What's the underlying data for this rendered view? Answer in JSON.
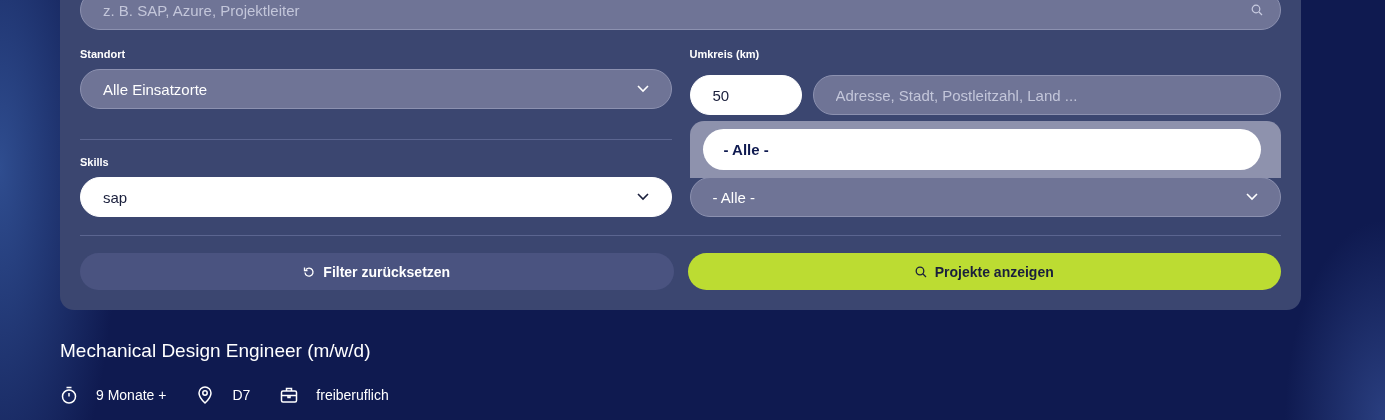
{
  "search": {
    "placeholder": "z. B. SAP, Azure, Projektleiter"
  },
  "location": {
    "label": "Standort",
    "value": "Alle Einsatzorte"
  },
  "radius": {
    "label": "Umkreis (km)",
    "value": "50",
    "address_placeholder": "Adresse, Stadt, Postleitzahl, Land ..."
  },
  "skills": {
    "label": "Skills",
    "value": "sap"
  },
  "open_dropdown": {
    "options": [
      {
        "label": "- Alle -",
        "selected": true
      }
    ]
  },
  "second_select": {
    "value": "- Alle -"
  },
  "buttons": [
    {
      "kind": "reset",
      "label": "Filter zurücksetzen"
    },
    {
      "kind": "search",
      "label": "Projekte anzeigen"
    }
  ],
  "job": {
    "title": "Mechanical Design Engineer (m/w/d)",
    "meta": [
      {
        "kind": "duration",
        "text": "9 Monate +"
      },
      {
        "kind": "location",
        "text": "D7"
      },
      {
        "kind": "employment",
        "text": "freiberuflich"
      }
    ]
  }
}
